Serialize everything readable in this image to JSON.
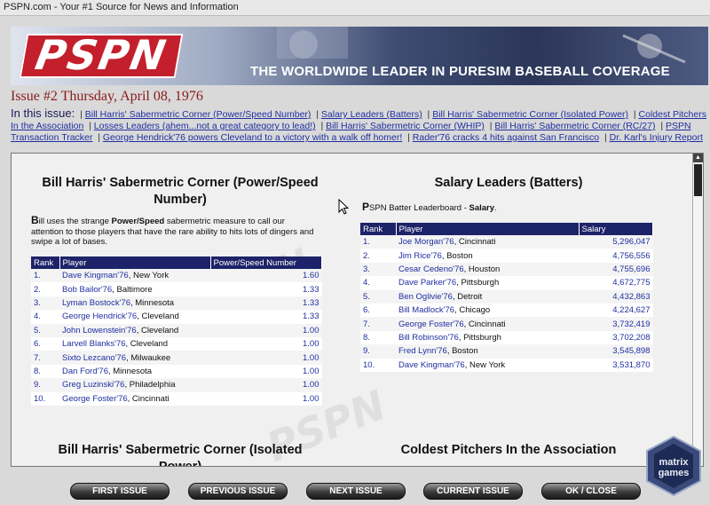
{
  "window": {
    "title": "PSPN.com - Your #1 Source for News and Information"
  },
  "banner": {
    "logo_text": "PSPN",
    "tagline": "THE WORLDWIDE LEADER IN PURESIM BASEBALL COVERAGE"
  },
  "issue": {
    "header": "Issue #2 Thursday, April 08, 1976",
    "in_this_issue_label": "In this issue:",
    "links": [
      "Bill Harris' Sabermetric Corner (Power/Speed Number)",
      "Salary Leaders (Batters)",
      "Bill Harris' Sabermetric Corner (Isolated Power)",
      "Coldest Pitchers In the Association",
      "Losses Leaders (ahem...not a great category to lead!)",
      "Bill Harris' Sabermetric Corner (WHIP)",
      "Bill Harris' Sabermetric Corner (RC/27)",
      "PSPN Transaction Tracker",
      "George Hendrick'76 powers Cleveland to a victory with a walk off homer!",
      "Rader'76 cracks 4 hits against San Francisco",
      "Dr. Karl's Injury Report"
    ]
  },
  "watermark": "PSPN",
  "power_speed": {
    "title": "Bill Harris' Sabermetric Corner (Power/Speed Number)",
    "desc_first_letter": "B",
    "desc_part1": "ill uses the strange ",
    "desc_bold": "Power/Speed",
    "desc_part2": " sabermetric measure to call our attention to those players that have the rare ability to hits lots of dingers and swipe a lot of bases.",
    "columns": [
      "Rank",
      "Player",
      "Power/Speed Number"
    ],
    "rows": [
      {
        "rank": "1.",
        "player": "Dave Kingman'76",
        "team": ", New York",
        "value": "1.60"
      },
      {
        "rank": "2.",
        "player": "Bob Bailor'76",
        "team": ", Baltimore",
        "value": "1.33"
      },
      {
        "rank": "3.",
        "player": "Lyman Bostock'76",
        "team": ", Minnesota",
        "value": "1.33"
      },
      {
        "rank": "4.",
        "player": "George Hendrick'76",
        "team": ", Cleveland",
        "value": "1.33"
      },
      {
        "rank": "5.",
        "player": "John Lowenstein'76",
        "team": ", Cleveland",
        "value": "1.00"
      },
      {
        "rank": "6.",
        "player": "Larvell Blanks'76",
        "team": ", Cleveland",
        "value": "1.00"
      },
      {
        "rank": "7.",
        "player": "Sixto Lezcano'76",
        "team": ", Milwaukee",
        "value": "1.00"
      },
      {
        "rank": "8.",
        "player": "Dan Ford'76",
        "team": ", Minnesota",
        "value": "1.00"
      },
      {
        "rank": "9.",
        "player": "Greg Luzinski'76",
        "team": ", Philadelphia",
        "value": "1.00"
      },
      {
        "rank": "10.",
        "player": "George Foster'76",
        "team": ", Cincinnati",
        "value": "1.00"
      }
    ]
  },
  "salary": {
    "title": "Salary Leaders (Batters)",
    "desc_first_letter": "P",
    "desc_part1": "SPN Batter Leaderboard - ",
    "desc_bold": "Salary",
    "desc_part2": ".",
    "columns": [
      "Rank",
      "Player",
      "Salary"
    ],
    "rows": [
      {
        "rank": "1.",
        "player": "Joe Morgan'76",
        "team": ", Cincinnati",
        "value": "5,296,047"
      },
      {
        "rank": "2.",
        "player": "Jim Rice'76",
        "team": ", Boston",
        "value": "4,756,556"
      },
      {
        "rank": "3.",
        "player": "Cesar Cedeno'76",
        "team": ", Houston",
        "value": "4,755,696"
      },
      {
        "rank": "4.",
        "player": "Dave Parker'76",
        "team": ", Pittsburgh",
        "value": "4,672,775"
      },
      {
        "rank": "5.",
        "player": "Ben Oglivie'76",
        "team": ", Detroit",
        "value": "4,432,863"
      },
      {
        "rank": "6.",
        "player": "Bill Madlock'76",
        "team": ", Chicago",
        "value": "4,224,627"
      },
      {
        "rank": "7.",
        "player": "George Foster'76",
        "team": ", Cincinnati",
        "value": "3,732,419"
      },
      {
        "rank": "8.",
        "player": "Bill Robinson'76",
        "team": ", Pittsburgh",
        "value": "3,702,208"
      },
      {
        "rank": "9.",
        "player": "Fred Lynn'76",
        "team": ", Boston",
        "value": "3,545,898"
      },
      {
        "rank": "10.",
        "player": "Dave Kingman'76",
        "team": ", New York",
        "value": "3,531,870"
      }
    ]
  },
  "isolated_power": {
    "title": "Bill Harris' Sabermetric Corner (Isolated Power)"
  },
  "coldest": {
    "title": "Coldest Pitchers In the Association"
  },
  "buttons": {
    "first": "FIRST ISSUE",
    "previous": "PREVIOUS ISSUE",
    "next": "NEXT ISSUE",
    "current": "CURRENT ISSUE",
    "ok": "OK / CLOSE"
  },
  "matrix_logo": {
    "line1": "matrix",
    "line2": "games"
  },
  "colors": {
    "header_red": "#8b1a1a",
    "table_header": "#1c2368",
    "link_blue": "#1f2fa0",
    "logo_red": "#c41f2c"
  }
}
